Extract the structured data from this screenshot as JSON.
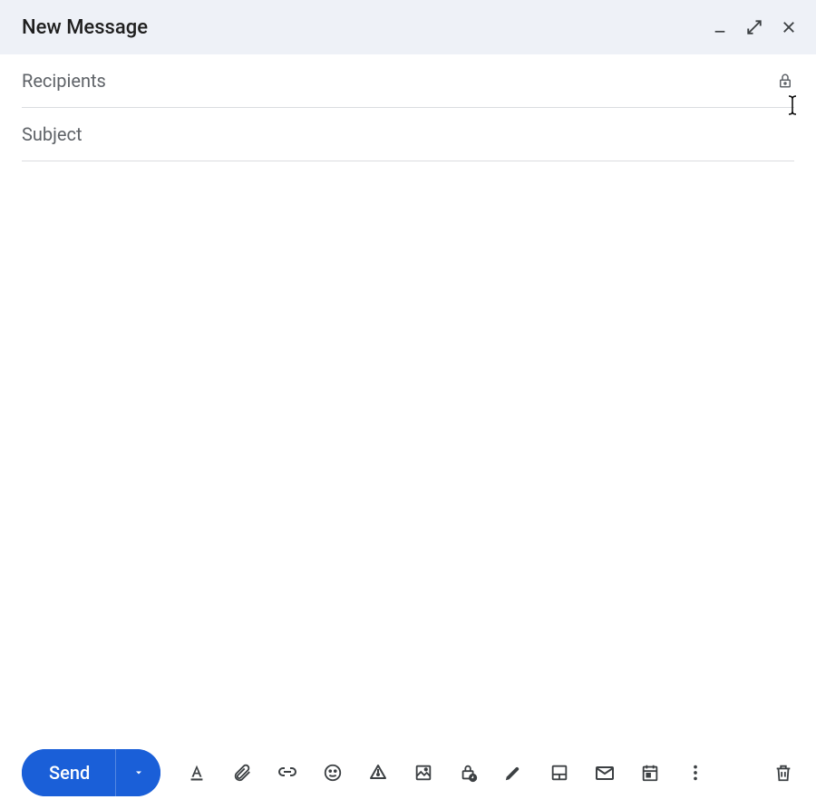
{
  "header": {
    "title": "New Message"
  },
  "fields": {
    "recipients": {
      "placeholder": "Recipients",
      "value": ""
    },
    "subject": {
      "placeholder": "Subject",
      "value": ""
    }
  },
  "body": {
    "value": ""
  },
  "footer": {
    "send_label": "Send"
  },
  "colors": {
    "header_bg": "#eef1f7",
    "send_bg": "#1a5fd8",
    "icon": "#3c4043",
    "placeholder": "#5f6368"
  }
}
